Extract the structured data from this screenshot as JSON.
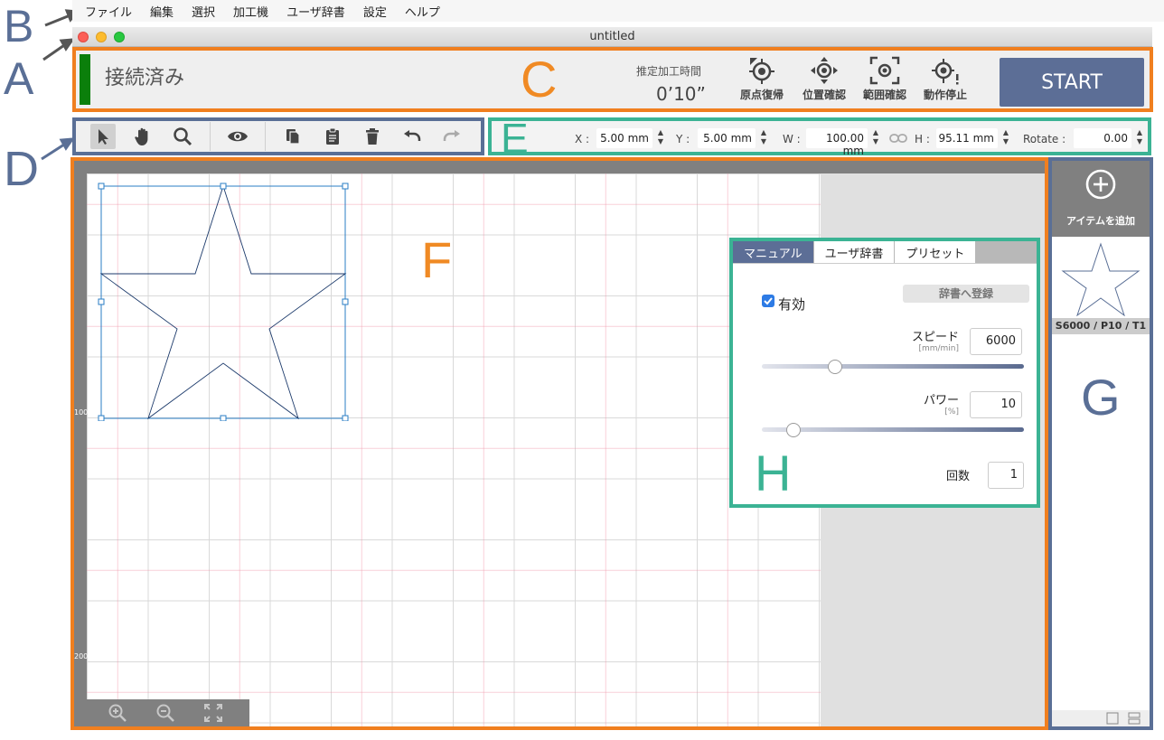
{
  "menubar": {
    "items": [
      "ファイル",
      "編集",
      "選択",
      "加工機",
      "ユーザ辞書",
      "設定",
      "ヘルプ"
    ]
  },
  "window": {
    "title": "untitled"
  },
  "annotations": {
    "a": "A",
    "b": "B",
    "c": "C",
    "d": "D",
    "e": "E",
    "f": "F",
    "g": "G",
    "h": "H"
  },
  "control_panel": {
    "connection_status": "接続済み",
    "estimated_time_label": "推定加工時間",
    "estimated_time_value": "0’10”",
    "buttons": {
      "home": "原点復帰",
      "position": "位置確認",
      "range": "範囲確認",
      "stop": "動作停止"
    },
    "start_label": "START",
    "status_color": "#0b7f0b"
  },
  "toolbar": {
    "tools": [
      "select-arrow-icon",
      "hand-pan-icon",
      "zoom-search-icon",
      "preview-eye-icon",
      "copy-icon",
      "paste-icon",
      "delete-trash-icon",
      "undo-icon",
      "redo-icon"
    ]
  },
  "properties": {
    "x_label": "X :",
    "x_value": "5.00 mm",
    "y_label": "Y :",
    "y_value": "5.00 mm",
    "w_label": "W :",
    "w_value": "100.00 mm",
    "h_label": "H :",
    "h_value": "95.11 mm",
    "rotate_label": "Rotate :",
    "rotate_value": "0.00"
  },
  "canvas": {
    "ruler_labels": [
      "100",
      "200"
    ]
  },
  "settings_panel": {
    "tabs": [
      "マニュアル",
      "ユーザ辞書",
      "プリセット"
    ],
    "active_tab": "マニュアル",
    "enabled_label": "有効",
    "enabled": true,
    "register_button": "辞書へ登録",
    "speed_label": "スピード",
    "speed_unit": "[mm/min]",
    "speed_value": "6000",
    "speed_slider": 0.28,
    "power_label": "パワー",
    "power_unit": "[%]",
    "power_value": "10",
    "power_slider": 0.12,
    "count_label": "回数",
    "count_value": "1"
  },
  "item_panel": {
    "add_label": "アイテムを追加",
    "item_label": "S6000 / P10 / T1"
  },
  "colors": {
    "accent_orange": "#f07f1f",
    "accent_teal": "#3bb394",
    "accent_slate": "#5a6f96",
    "start_button": "#5c6e96"
  }
}
